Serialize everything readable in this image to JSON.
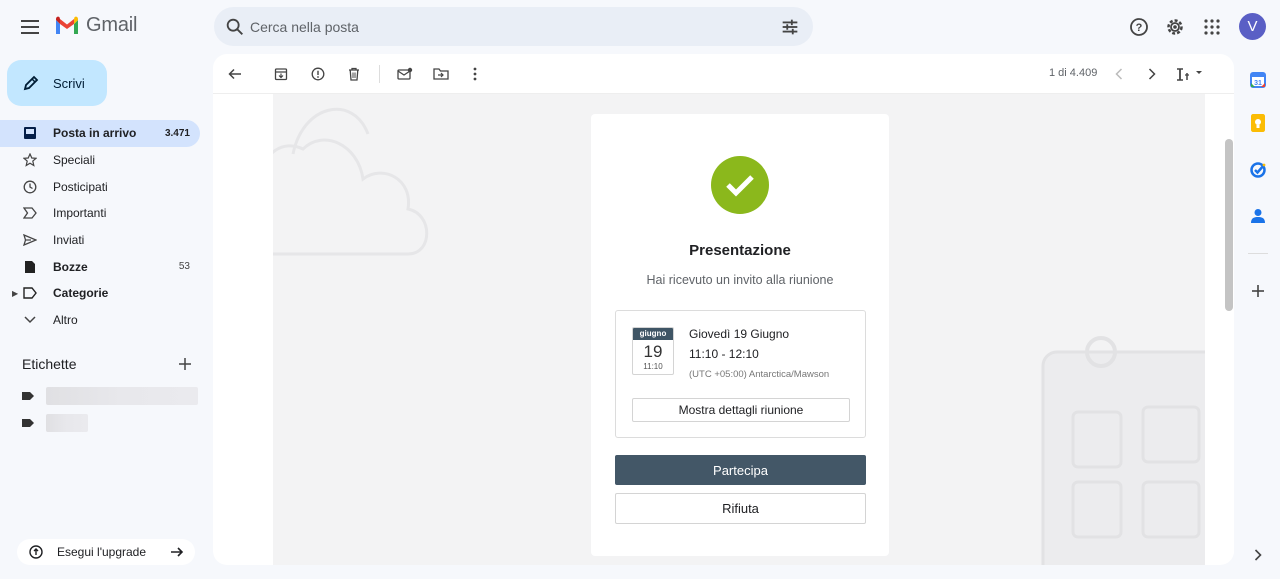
{
  "app": {
    "name": "Gmail"
  },
  "search": {
    "placeholder": "Cerca nella posta"
  },
  "user": {
    "initial": "V"
  },
  "compose": {
    "label": "Scrivi"
  },
  "nav": [
    {
      "label": "Posta in arrivo",
      "count": "3.471",
      "icon": "inbox-icon"
    },
    {
      "label": "Speciali",
      "count": "",
      "icon": "star-icon"
    },
    {
      "label": "Posticipati",
      "count": "",
      "icon": "clock-icon"
    },
    {
      "label": "Importanti",
      "count": "",
      "icon": "important-icon"
    },
    {
      "label": "Inviati",
      "count": "",
      "icon": "send-icon"
    },
    {
      "label": "Bozze",
      "count": "53",
      "icon": "draft-icon"
    },
    {
      "label": "Categorie",
      "count": "",
      "icon": "label-icon"
    },
    {
      "label": "Altro",
      "count": "",
      "icon": "chevron-down-icon"
    }
  ],
  "labels": {
    "title": "Etichette"
  },
  "upgrade": {
    "label": "Esegui l'upgrade"
  },
  "pager": {
    "text": "1 di 4.409"
  },
  "invite": {
    "title": "Presentazione",
    "subtitle": "Hai ricevuto un invito alla riunione",
    "calendar": {
      "month": "giugno",
      "day": "19",
      "time": "11:10"
    },
    "date": "Giovedì 19 Giugno",
    "time_range": "11:10 - 12:10",
    "timezone": "(UTC +05:00) Antarctica/Mawson",
    "details_label": "Mostra dettagli riunione",
    "join_label": "Partecipa",
    "decline_label": "Rifiuta"
  },
  "colors": {
    "accent": "#8bb81c",
    "join": "#435767",
    "compose": "#c2e7ff",
    "active_nav": "#d3e3fd"
  }
}
